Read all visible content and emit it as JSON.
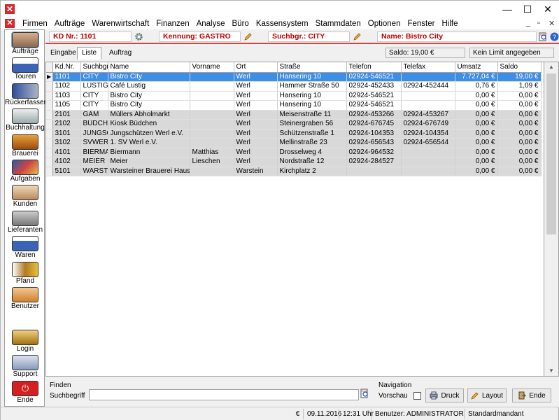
{
  "window": {
    "minimize": "—",
    "maximize": "☐",
    "close": "✕"
  },
  "menu": {
    "items": [
      "Firmen",
      "Aufträge",
      "Warenwirtschaft",
      "Finanzen",
      "Analyse",
      "Büro",
      "Kassensystem",
      "Stammdaten",
      "Optionen",
      "Fenster",
      "Hilfe"
    ]
  },
  "sidebar": {
    "items": [
      "Aufträge",
      "Touren",
      "Rückerfassen",
      "Buchhaltung",
      "Brauerei",
      "Aufgaben",
      "Kunden",
      "Lieferanten",
      "Waren",
      "Pfand",
      "Benutzer",
      "Login",
      "Support",
      "Ende"
    ]
  },
  "header": {
    "kd_nr": "KD Nr.: 1101",
    "kennung": "Kennung: GASTRO",
    "suchbgr": "Suchbgr.: CITY",
    "name": "Name: Bistro City"
  },
  "tabs": [
    "Eingabe",
    "Liste",
    "Auftrag"
  ],
  "saldo": "Saldo: 19,00 €",
  "limit": "Kein Limit angegeben",
  "table": {
    "columns": [
      "Kd.Nr.",
      "Suchbgr.",
      "Name",
      "Vorname",
      "Ort",
      "Straße",
      "Telefon",
      "Telefax",
      "Umsatz",
      "Saldo"
    ],
    "rows": [
      [
        "1101",
        "CITY",
        "Bistro City",
        "",
        "Werl",
        "Hansering 10",
        "02924-546521",
        "",
        "7.727,04 €",
        "19,00 €"
      ],
      [
        "1102",
        "LUSTIG",
        "Café Lustig",
        "",
        "Werl",
        "Hammer Straße 50",
        "02924-452433",
        "02924-452444",
        "0,76 €",
        "1,09 €"
      ],
      [
        "1103",
        "CITY",
        "Bistro City",
        "",
        "Werl",
        "Hansering 10",
        "02924-546521",
        "",
        "0,00 €",
        "0,00 €"
      ],
      [
        "1105",
        "CITY",
        "Bistro City",
        "",
        "Werl",
        "Hansering 10",
        "02924-546521",
        "",
        "0,00 €",
        "0,00 €"
      ],
      [
        "2101",
        "GAM",
        "Müllers Abholmarkt",
        "",
        "Werl",
        "Meisenstraße 11",
        "02924-453266",
        "02924-453267",
        "0,00 €",
        "0,00 €"
      ],
      [
        "2102",
        "BÜDCHEN",
        "Kiosk Büdchen",
        "",
        "Werl",
        "Steinergraben 56",
        "02924-676745",
        "02924-676749",
        "0,00 €",
        "0,00 €"
      ],
      [
        "3101",
        "JUNGSCH",
        "Jungschützen Werl e.V.",
        "",
        "Werl",
        "Schützenstraße 1",
        "02924-104353",
        "02924-104354",
        "0,00 €",
        "0,00 €"
      ],
      [
        "3102",
        "SVWERL",
        "1. SV Werl e.V.",
        "",
        "Werl",
        "Mellinstraße 23",
        "02924-656543",
        "02924-656544",
        "0,00 €",
        "0,00 €"
      ],
      [
        "4101",
        "BIERMAN",
        "Biermann",
        "Matthias",
        "Werl",
        "Drosselweg 4",
        "02924-964532",
        "",
        "0,00 €",
        "0,00 €"
      ],
      [
        "4102",
        "MEIER",
        "Meier",
        "Lieschen",
        "Werl",
        "Nordstraße 12",
        "02924-284527",
        "",
        "0,00 €",
        "0,00 €"
      ],
      [
        "5101",
        "WARSTE",
        "Warsteiner Brauerei Haus Cram",
        "",
        "Warstein",
        "Kirchplatz 2",
        "",
        "",
        "0,00 €",
        "0,00 €"
      ]
    ]
  },
  "find": {
    "title": "Finden",
    "label": "Suchbegriff",
    "value": ""
  },
  "navigation": {
    "title": "Navigation",
    "preview": "Vorschau",
    "print": "Druck",
    "layout": "Layout",
    "end": "Ende"
  },
  "status": {
    "currency": "€",
    "date": "09.11.2016",
    "time": "12:31 Uhr",
    "user": "Benutzer: ADMINISTRATOR",
    "client": "Standardmandant"
  }
}
